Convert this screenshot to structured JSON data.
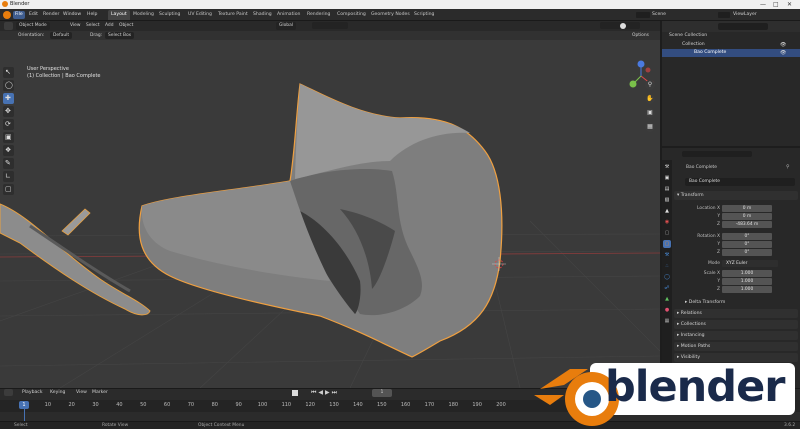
{
  "titlebar": {
    "title": "Blender"
  },
  "menu": {
    "items": [
      "File",
      "Edit",
      "Render",
      "Window",
      "Help"
    ],
    "workspaces": [
      "Layout",
      "Modeling",
      "Sculpting",
      "UV Editing",
      "Texture Paint",
      "Shading",
      "Animation",
      "Rendering",
      "Compositing",
      "Geometry Nodes",
      "Scripting"
    ],
    "active_workspace": "Layout",
    "scene": "Scene",
    "view_layer": "ViewLayer"
  },
  "viewport_header": {
    "mode": "Object Mode",
    "menus": [
      "View",
      "Select",
      "Add",
      "Object"
    ],
    "transform": "Global",
    "orientation_label": "Orientation:",
    "orientation_value": "Default",
    "drag_label": "Drag:",
    "drag_value": "Select Box",
    "options": "Options"
  },
  "viewport": {
    "perspective": "User Perspective",
    "collection_info": "(1) Collection | Bao Complete"
  },
  "outliner": {
    "root": "Scene Collection",
    "collection": "Collection",
    "object": "Bao Complete"
  },
  "properties": {
    "object_name": "Bao Complete",
    "object_field": "Bao Complete",
    "transform_title": "Transform",
    "location": [
      {
        "label": "Location X",
        "value": "0 m"
      },
      {
        "label": "Y",
        "value": "0 m"
      },
      {
        "label": "Z",
        "value": "-483.64 m"
      }
    ],
    "rotation": [
      {
        "label": "Rotation X",
        "value": "0°"
      },
      {
        "label": "Y",
        "value": "0°"
      },
      {
        "label": "Z",
        "value": "0°"
      }
    ],
    "mode_label": "Mode",
    "mode_value": "XYZ Euler",
    "scale": [
      {
        "label": "Scale X",
        "value": "1.000"
      },
      {
        "label": "Y",
        "value": "1.000"
      },
      {
        "label": "Z",
        "value": "1.000"
      }
    ],
    "delta_transform": "Delta Transform",
    "sections": [
      "Relations",
      "Collections",
      "Instancing",
      "Motion Paths",
      "Visibility"
    ]
  },
  "timeline": {
    "menus": [
      "Playback",
      "Keying",
      "View",
      "Marker"
    ],
    "current_frame": "1",
    "frame_box": "1",
    "ticks": [
      "10",
      "20",
      "30",
      "40",
      "50",
      "60",
      "70",
      "80",
      "90",
      "100",
      "110",
      "120",
      "130",
      "140",
      "150",
      "160",
      "170",
      "180",
      "190",
      "200"
    ]
  },
  "status": {
    "select": "Select",
    "rotate": "Rotate View",
    "context": "Object Context Menu",
    "version": "3.6.2"
  },
  "logo": {
    "text": "blender",
    "brand_orange": "#e87d0d",
    "brand_blue": "#265787"
  },
  "colors": {
    "selection_outline": "#f0a040",
    "accent": "#4772b3"
  }
}
